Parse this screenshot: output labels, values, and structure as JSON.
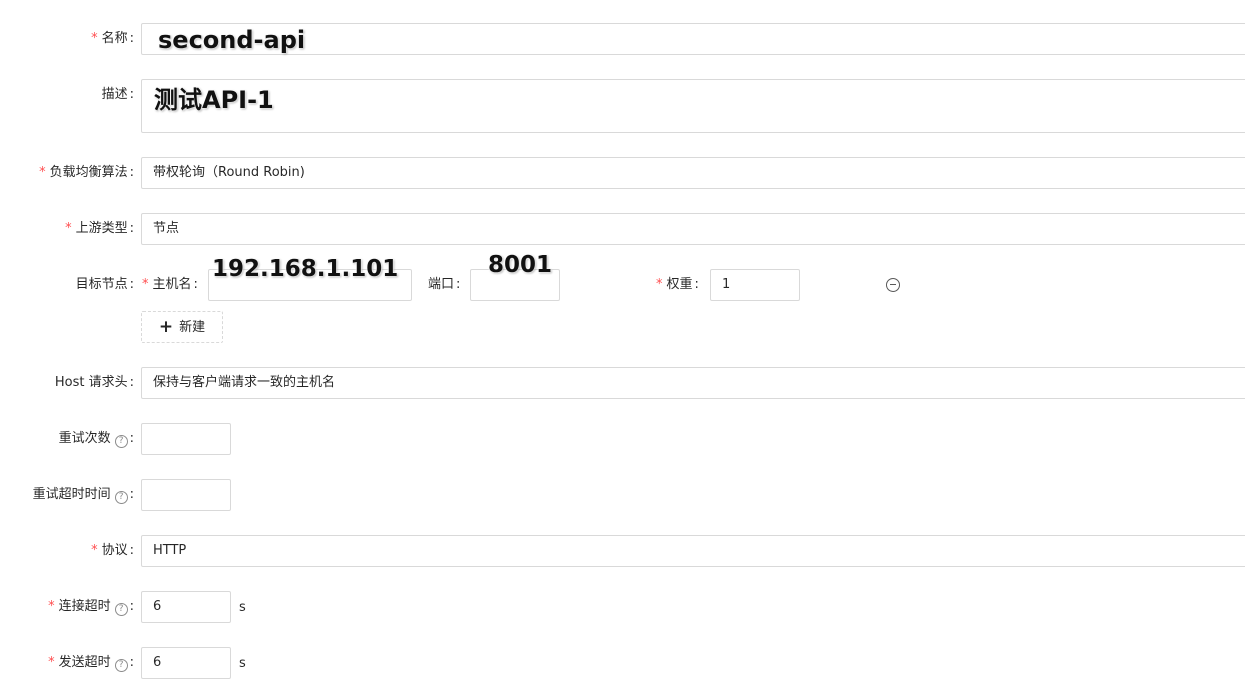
{
  "form": {
    "name": {
      "required": true,
      "label": "名称",
      "value": "second-api"
    },
    "description": {
      "required": false,
      "label": "描述",
      "value": "测试API-1"
    },
    "lb_algorithm": {
      "required": true,
      "label": "负载均衡算法",
      "value": "带权轮询（Round Robin)"
    },
    "upstream_type": {
      "required": true,
      "label": "上游类型",
      "value": "节点"
    },
    "target_nodes": {
      "label": "目标节点",
      "host_label": "主机名",
      "host_value": "192.168.1.101",
      "port_label": "端口",
      "port_value": "8001",
      "weight_label": "权重",
      "weight_value": "1",
      "add_label": "新建"
    },
    "host_header": {
      "required": false,
      "label": "Host 请求头",
      "value": "保持与客户端请求一致的主机名"
    },
    "retry_count": {
      "required": false,
      "label": "重试次数",
      "value": ""
    },
    "retry_timeout": {
      "required": false,
      "label": "重试超时时间",
      "value": ""
    },
    "protocol": {
      "required": true,
      "label": "协议",
      "value": "HTTP"
    },
    "connect_timeout": {
      "required": true,
      "label": "连接超时",
      "value": "6",
      "unit": "s"
    },
    "send_timeout": {
      "required": true,
      "label": "发送超时",
      "value": "6",
      "unit": "s"
    }
  },
  "colors": {
    "required_mark": "#ff4d4f",
    "border": "#d9d9d9"
  },
  "marks": {
    "required": "*",
    "colon": ":",
    "help_icon": "?"
  }
}
